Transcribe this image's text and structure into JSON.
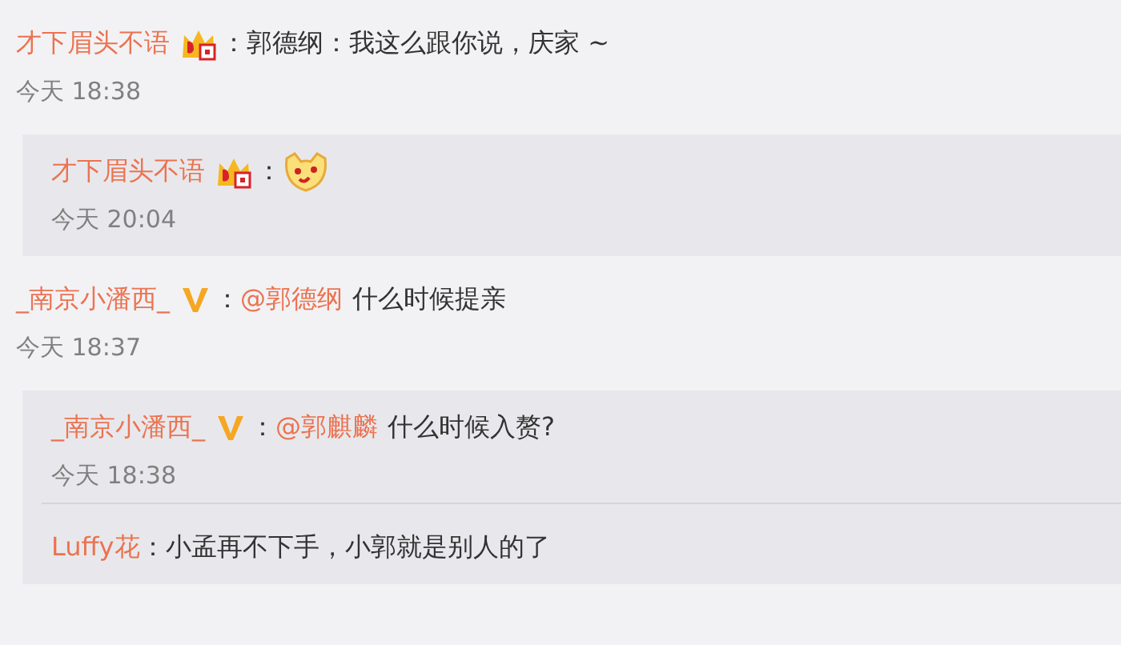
{
  "comments": [
    {
      "user": "才下眉头不语",
      "badge": {
        "kind": "crown"
      },
      "colon": "：",
      "content": [
        {
          "kind": "text",
          "text": "郭德纲：我这么跟你说，庆家 ~"
        }
      ],
      "time": "今天 18:38",
      "replies": [
        {
          "user": "才下眉头不语",
          "badge": {
            "kind": "crown"
          },
          "colon": "：",
          "content": [
            {
              "kind": "emoji"
            }
          ],
          "time": "今天 20:04"
        }
      ]
    },
    {
      "user": "_南京小潘西_",
      "badge": {
        "kind": "verified"
      },
      "colon": "：",
      "content": [
        {
          "kind": "mention",
          "text": "@郭德纲"
        },
        {
          "kind": "text",
          "text": "什么时候提亲"
        }
      ],
      "time": "今天 18:37",
      "replies": [
        {
          "user": "_南京小潘西_",
          "badge": {
            "kind": "verified"
          },
          "colon": "：",
          "content": [
            {
              "kind": "mention",
              "text": "@郭麒麟"
            },
            {
              "kind": "text",
              "text": "什么时候入赘?"
            }
          ],
          "time": "今天 18:38"
        },
        {
          "user": "Luffy花",
          "colon": "：",
          "content": [
            {
              "kind": "text",
              "text": "小孟再不下手，小郭就是别人的了"
            }
          ]
        }
      ]
    }
  ]
}
